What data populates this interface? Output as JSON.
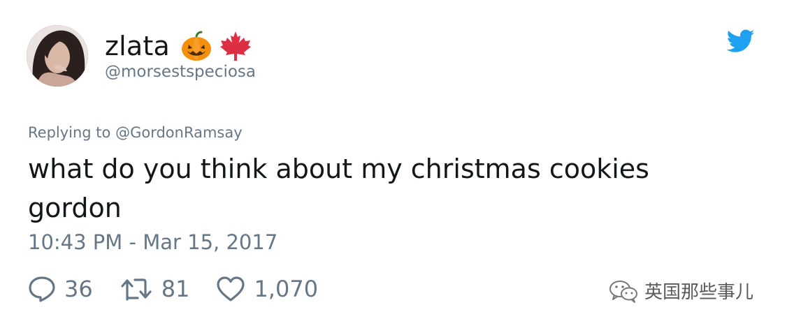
{
  "user": {
    "display_name": "zlata",
    "handle": "@morsestspeciosa",
    "emojis": [
      "pumpkin-icon",
      "maple-leaf-icon"
    ]
  },
  "reply": {
    "prefix": "Replying to ",
    "mention": "@GordonRamsay"
  },
  "tweet": {
    "text": "what do you think about my christmas cookies gordon",
    "timestamp": "10:43 PM - Mar 15, 2017"
  },
  "actions": {
    "reply_count": "36",
    "retweet_count": "81",
    "like_count": "1,070"
  },
  "watermark": {
    "text": "英国那些事儿"
  },
  "colors": {
    "twitter_blue": "#1da1f2",
    "text_primary": "#14171a",
    "text_secondary": "#657786"
  }
}
